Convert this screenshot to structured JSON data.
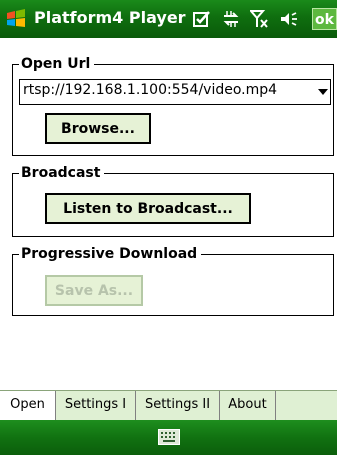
{
  "titlebar": {
    "title": "Platform4 Player",
    "ok_label": "ok",
    "icons": [
      "windows-start-icon",
      "tasks-icon",
      "connectivity-icon",
      "signal-icon",
      "volume-icon"
    ]
  },
  "open_url": {
    "legend": "Open Url",
    "url_value": "rtsp://192.168.1.100:554/video.mp4",
    "browse_label": "Browse..."
  },
  "broadcast": {
    "legend": "Broadcast",
    "listen_label": "Listen to Broadcast..."
  },
  "progressive": {
    "legend": "Progressive Download",
    "save_as_label": "Save As..."
  },
  "tabs": [
    {
      "label": "Open",
      "active": true
    },
    {
      "label": "Settings I",
      "active": false
    },
    {
      "label": "Settings II",
      "active": false
    },
    {
      "label": "About",
      "active": false
    }
  ],
  "bottombar": {
    "icon": "keyboard-icon"
  },
  "colors": {
    "title_green": "#0f6e0f",
    "ok_green": "#5db83f",
    "button_fill": "#e6f2d6",
    "tab_strip": "#dff0d3"
  }
}
